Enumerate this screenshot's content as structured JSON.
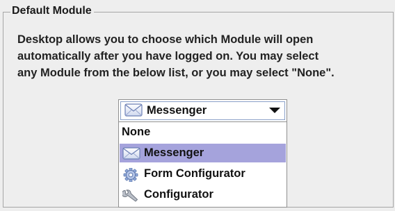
{
  "group": {
    "title": "Default Module"
  },
  "description": {
    "lines": [
      "Desktop allows you to choose which Module will open",
      "automatically after you have logged on.  You may select",
      "any Module from the below list, or you may select \"None\"."
    ]
  },
  "combo": {
    "selected_label": "Messenger",
    "selected_icon": "envelope-icon"
  },
  "options": [
    {
      "label": "None",
      "icon": ""
    },
    {
      "label": "Messenger",
      "icon": "envelope-icon",
      "highlighted": true
    },
    {
      "label": "Form Configurator",
      "icon": "gear-icon"
    },
    {
      "label": "Configurator",
      "icon": "wrench-icon"
    }
  ],
  "colors": {
    "highlight": "#a5a3dc",
    "background": "#eeeeee"
  }
}
